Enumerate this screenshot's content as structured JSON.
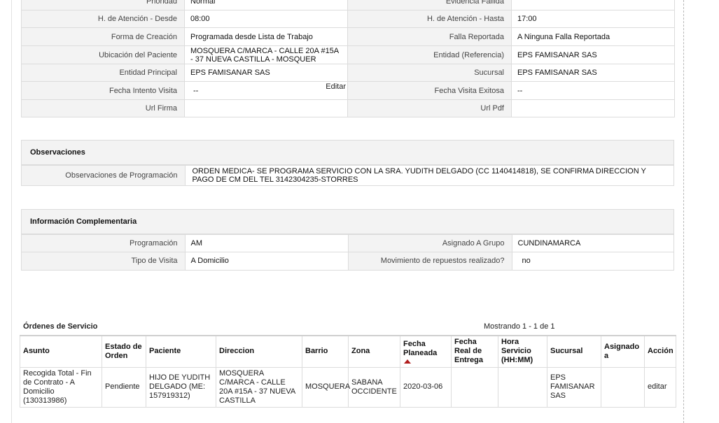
{
  "top_grid": {
    "rows": [
      {
        "l1": "Prioridad",
        "v1": "Normal",
        "l2": "Evidencia Fallida",
        "v2": ""
      },
      {
        "l1": "H. de Atención - Desde",
        "v1": "08:00",
        "l2": "H. de Atención - Hasta",
        "v2": "17:00"
      },
      {
        "l1": "Forma de Creación",
        "v1": "Programada desde Lista de Trabajo",
        "l2": "Falla Reportada",
        "v2": "A Ninguna Falla Reportada"
      },
      {
        "l1": "Ubicación del Paciente",
        "v1": "MOSQUERA C/MARCA - CALLE 20A #15A - 37 NUEVA CASTILLA - MOSQUER",
        "l2": "Entidad (Referencia)",
        "v2": "EPS FAMISANAR SAS"
      },
      {
        "l1": "Entidad Principal",
        "v1": "EPS FAMISANAR SAS",
        "l2": "Sucursal",
        "v2": "EPS FAMISANAR SAS"
      },
      {
        "l1": "Fecha Intento Visita",
        "v1": "--",
        "l2": "Fecha Visita Exitosa",
        "v2": "--"
      },
      {
        "l1": "Url Firma",
        "v1": "",
        "l2": "Url Pdf",
        "v2": ""
      }
    ],
    "edit_label": "Editar"
  },
  "observaciones": {
    "title": "Observaciones",
    "label": "Observaciones de Programación",
    "value": "ORDEN MEDICA- SE PROGRAMA SERVICIO CON LA SRA. YUDITH DELGADO (CC 1140414818), SE CONFIRMA DIRECCION Y PAGO DE CM DEL TEL 3142304235-STORRES"
  },
  "info_complementaria": {
    "title": "Información Complementaria",
    "rows": [
      {
        "l1": "Programación",
        "v1": "AM",
        "l2": "Asignado A Grupo",
        "v2": "CUNDINAMARCA"
      },
      {
        "l1": "Tipo de Visita",
        "v1": "A Domicilio",
        "l2": "Movimiento de repuestos realizado?",
        "v2": "no"
      }
    ]
  },
  "ordenes": {
    "title": "Órdenes de Servicio",
    "showing": "Mostrando 1 - 1 de 1",
    "headers": {
      "asunto": "Asunto",
      "estado": "Estado de Orden",
      "paciente": "Paciente",
      "direccion": "Direccion",
      "barrio": "Barrio",
      "zona": "Zona",
      "fecha_planeada": "Fecha Planeada",
      "fecha_real": "Fecha Real de Entrega",
      "hora": "Hora Servicio (HH:MM)",
      "sucursal": "Sucursal",
      "asignado": "Asignado a",
      "accion": "Acción"
    },
    "rows": [
      {
        "asunto": "Recogida Total - Fin de Contrato - A Domicilio (130313986)",
        "estado": "Pendiente",
        "paciente": "HIJO DE YUDITH DELGADO (ME: 157919312)",
        "direccion": "MOSQUERA C/MARCA - CALLE 20A #15A - 37 NUEVA CASTILLA",
        "barrio": "MOSQUERA",
        "zona": "SABANA OCCIDENTE",
        "fecha_planeada": "2020-03-06",
        "fecha_real": "",
        "hora": "",
        "sucursal": "EPS FAMISANAR SAS",
        "asignado": "",
        "accion": "editar"
      }
    ]
  },
  "colors": {
    "sort_indicator": "#b11d1d",
    "label_bg": "#f3f3f3",
    "border": "#dcdcdc"
  }
}
